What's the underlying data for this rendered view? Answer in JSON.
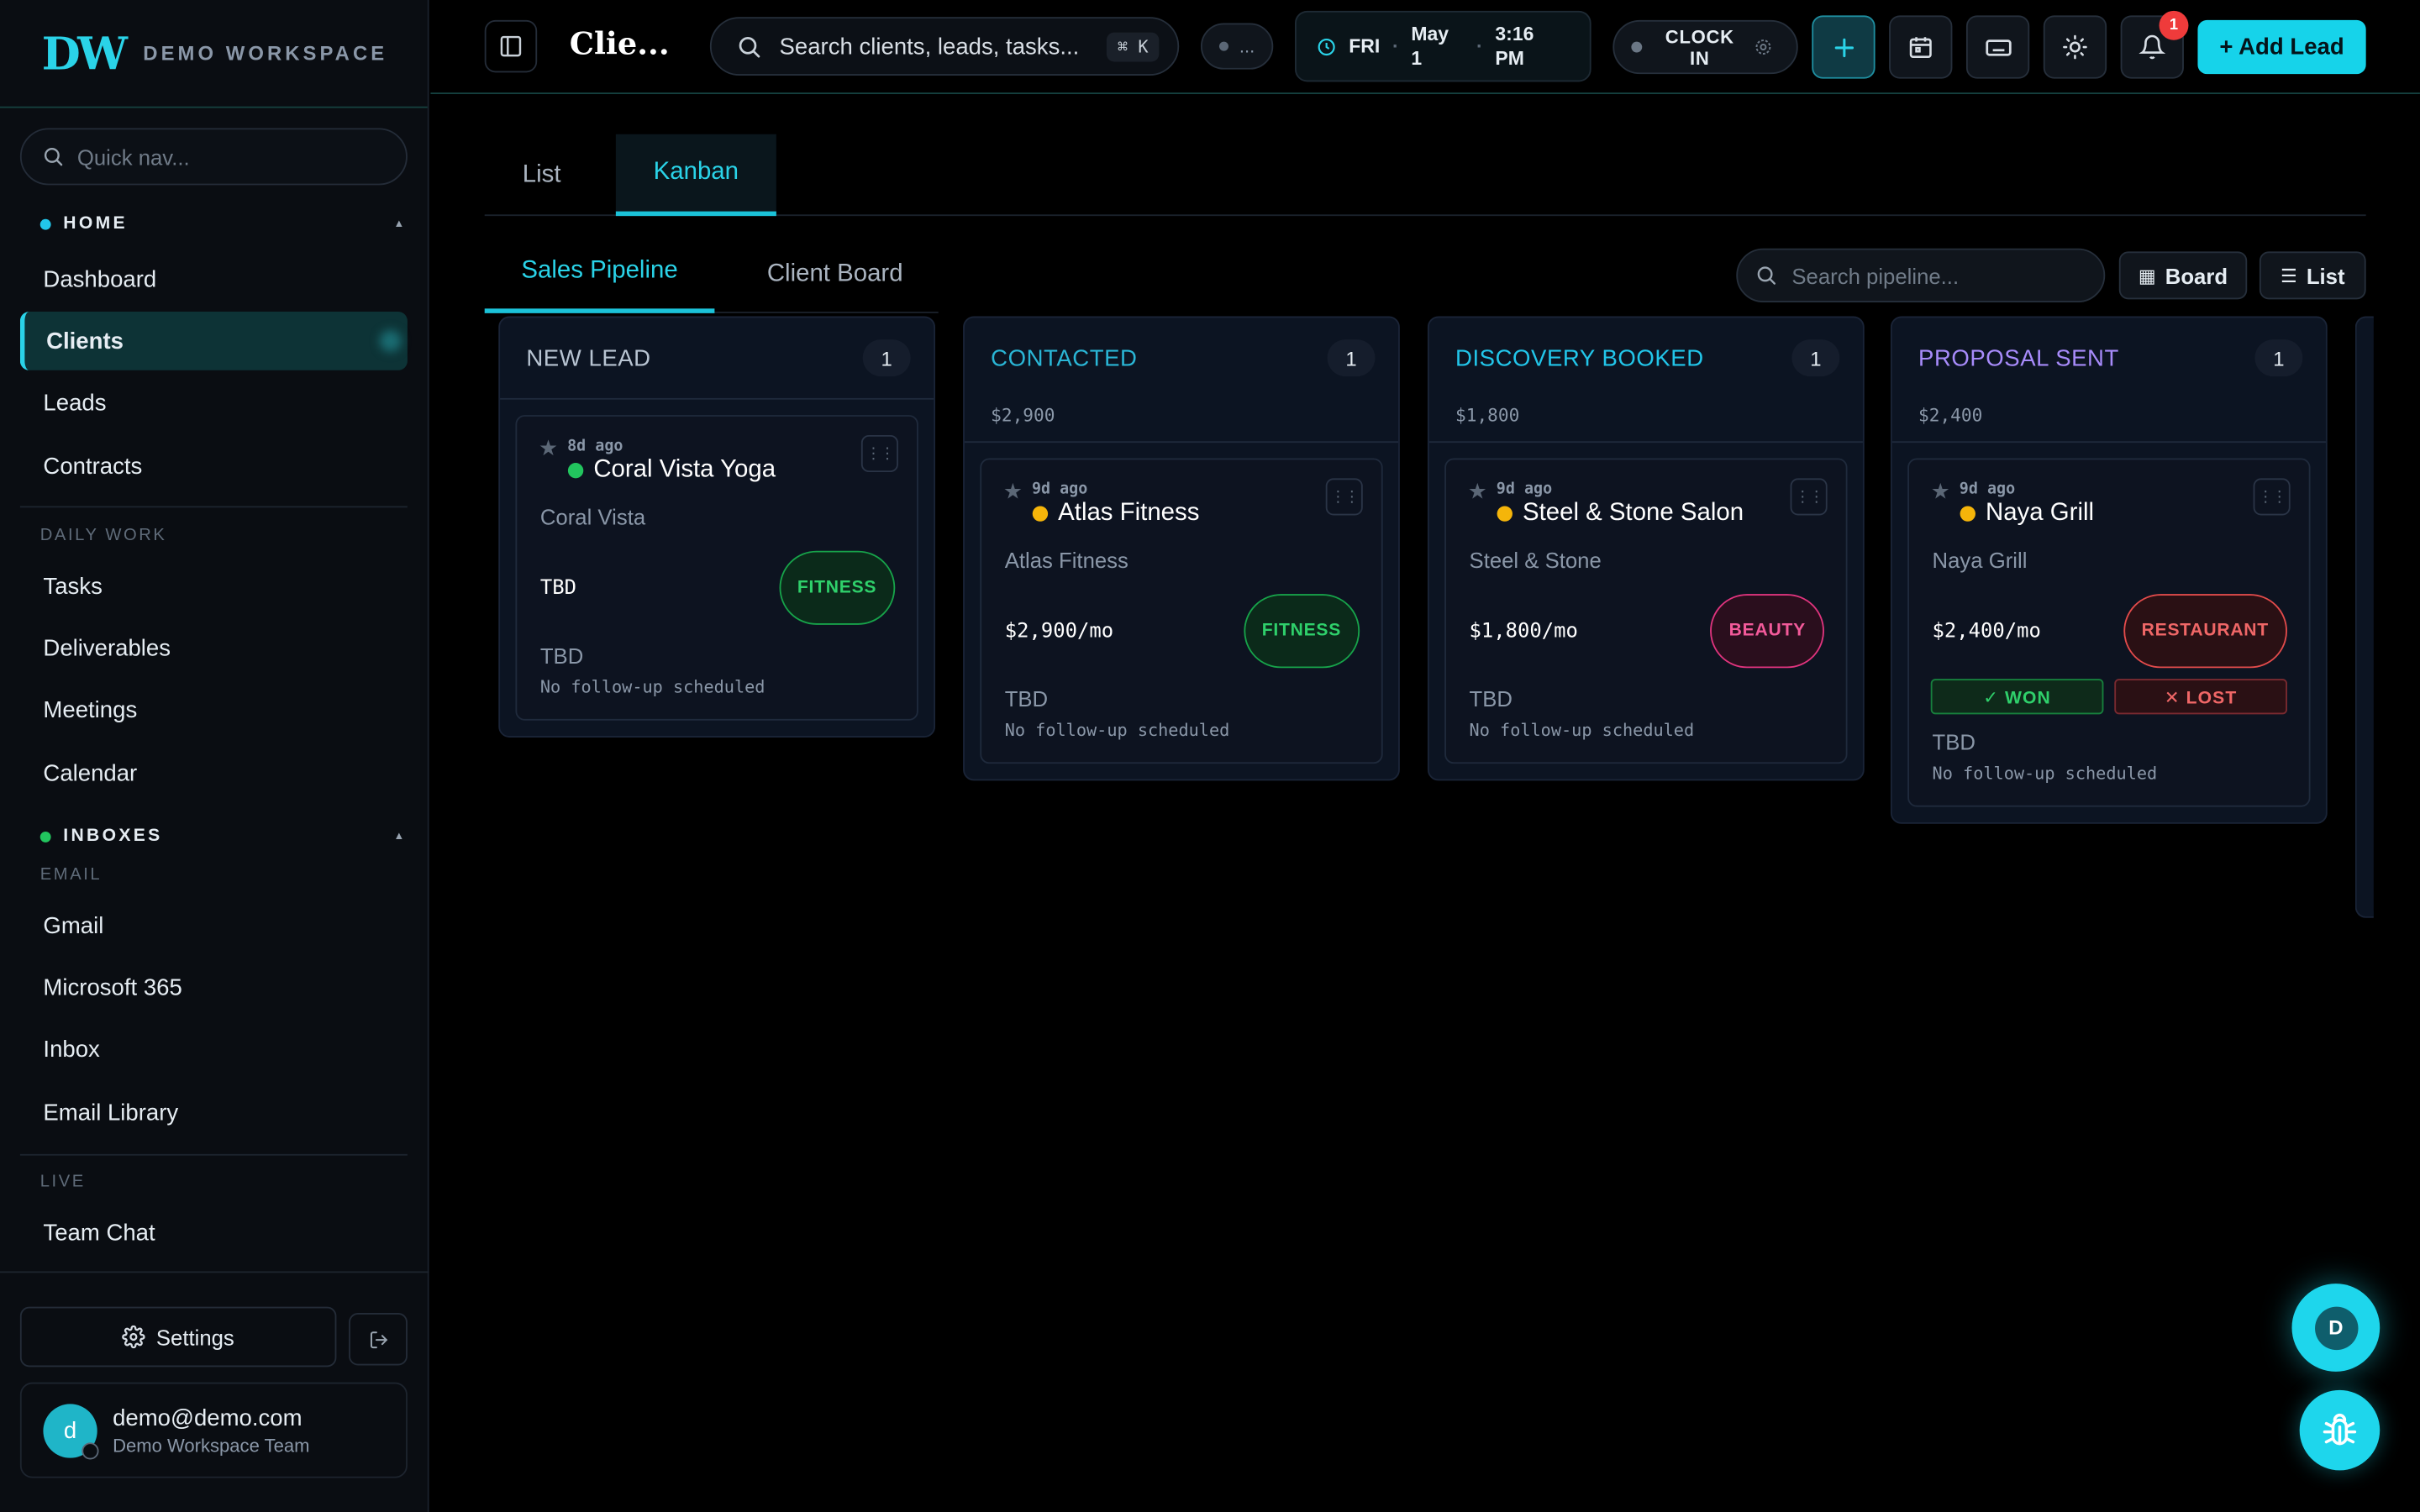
{
  "brand": {
    "logo": "DW",
    "name": "DEMO WORKSPACE"
  },
  "sidebar": {
    "quicknav_placeholder": "Quick nav...",
    "home_label": "HOME",
    "home_items": [
      "Dashboard",
      "Clients",
      "Leads",
      "Contracts"
    ],
    "daily_label": "DAILY WORK",
    "daily_items": [
      "Tasks",
      "Deliverables",
      "Meetings",
      "Calendar"
    ],
    "inboxes_label": "INBOXES",
    "email_label": "EMAIL",
    "email_items": [
      "Gmail",
      "Microsoft 365",
      "Inbox",
      "Email Library"
    ],
    "live_label": "LIVE",
    "live_items": [
      "Team Chat"
    ],
    "settings_label": "Settings",
    "user": {
      "initial": "d",
      "email": "demo@demo.com",
      "team": "Demo Workspace Team"
    }
  },
  "topbar": {
    "title": "Clie...",
    "search_text": "Search clients, leads, tasks...",
    "search_shortcut": "⌘ K",
    "status_text": "...",
    "day": "FRI",
    "date_line1": "May",
    "date_line2": "1",
    "time_line1": "3:16",
    "time_line2": "PM",
    "clockin_line1": "CLOCK",
    "clockin_line2": "IN",
    "notification_count": "1",
    "add_lead_label": "+ Add Lead"
  },
  "view_tabs": [
    "List",
    "Kanban"
  ],
  "pipeline_tabs": [
    "Sales Pipeline",
    "Client Board"
  ],
  "pipeline_search_placeholder": "Search pipeline...",
  "view_buttons": {
    "board": "Board",
    "list": "List"
  },
  "columns": [
    {
      "title": "NEW LEAD",
      "count": "1",
      "value": "",
      "color": "#b8c4d2",
      "card": {
        "ago": "8d ago",
        "name": "Coral Vista Yoga",
        "dot_color": "#22c55e",
        "company": "Coral Vista",
        "amount": "TBD",
        "tag": "FITNESS",
        "stage": "TBD",
        "followup": "No follow-up scheduled"
      }
    },
    {
      "title": "CONTACTED",
      "count": "1",
      "value": "$2,900",
      "color": "#2ab6d6",
      "card": {
        "ago": "9d ago",
        "name": "Atlas Fitness",
        "dot_color": "#f5b50a",
        "company": "Atlas Fitness",
        "amount": "$2,900/mo",
        "tag": "FITNESS",
        "stage": "TBD",
        "followup": "No follow-up scheduled"
      }
    },
    {
      "title": "DISCOVERY BOOKED",
      "count": "1",
      "value": "$1,800",
      "color": "#22c6ea",
      "card": {
        "ago": "9d ago",
        "name": "Steel & Stone Salon",
        "dot_color": "#f5b50a",
        "company": "Steel & Stone",
        "amount": "$1,800/mo",
        "tag": "BEAUTY",
        "stage": "TBD",
        "followup": "No follow-up scheduled"
      }
    },
    {
      "title": "PROPOSAL SENT",
      "count": "1",
      "value": "$2,400",
      "color": "#a78bfa",
      "card": {
        "ago": "9d ago",
        "name": "Naya Grill",
        "dot_color": "#f5b50a",
        "company": "Naya Grill",
        "amount": "$2,400/mo",
        "tag": "RESTAURANT",
        "won_label": "✓ WON",
        "lost_label": "✕ LOST",
        "stage": "TBD",
        "followup": "No follow-up scheduled"
      }
    }
  ],
  "fab_initial": "D"
}
